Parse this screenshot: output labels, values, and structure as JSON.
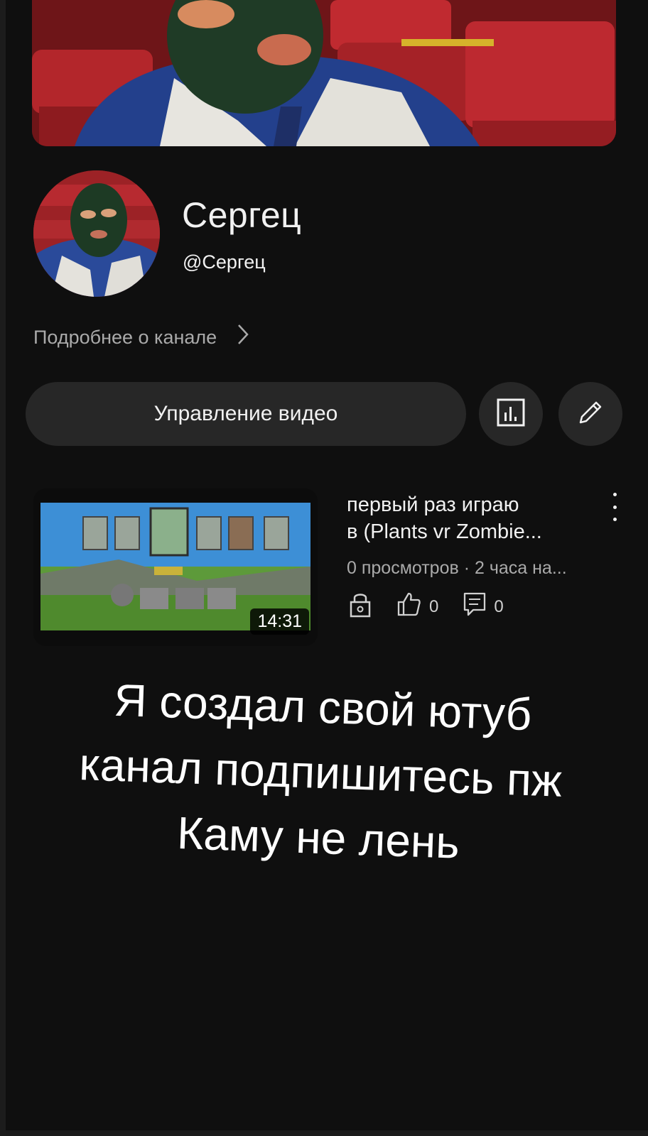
{
  "channel": {
    "name": "Сергец",
    "handle": "@Сергец",
    "more_label": "Подробнее о канале"
  },
  "actions": {
    "manage_videos_label": "Управление видео",
    "stats_icon": "analytics-icon",
    "edit_icon": "pencil-icon"
  },
  "video": {
    "title_line1": "первый раз играю",
    "title_line2": "в (Plants vr Zombie...",
    "meta": "0 просмотров · 2 часа на...",
    "duration": "14:31",
    "likes": "0",
    "comments": "0",
    "visibility_icon": "lock-icon"
  },
  "overlay_caption": {
    "line1": "Я создал свой ютуб",
    "line2": "канал подпишитесь пж",
    "line3": "Каму не лень"
  },
  "colors": {
    "background": "#0f0f0f",
    "button_bg": "#272727",
    "secondary_text": "#aaaaaa"
  }
}
